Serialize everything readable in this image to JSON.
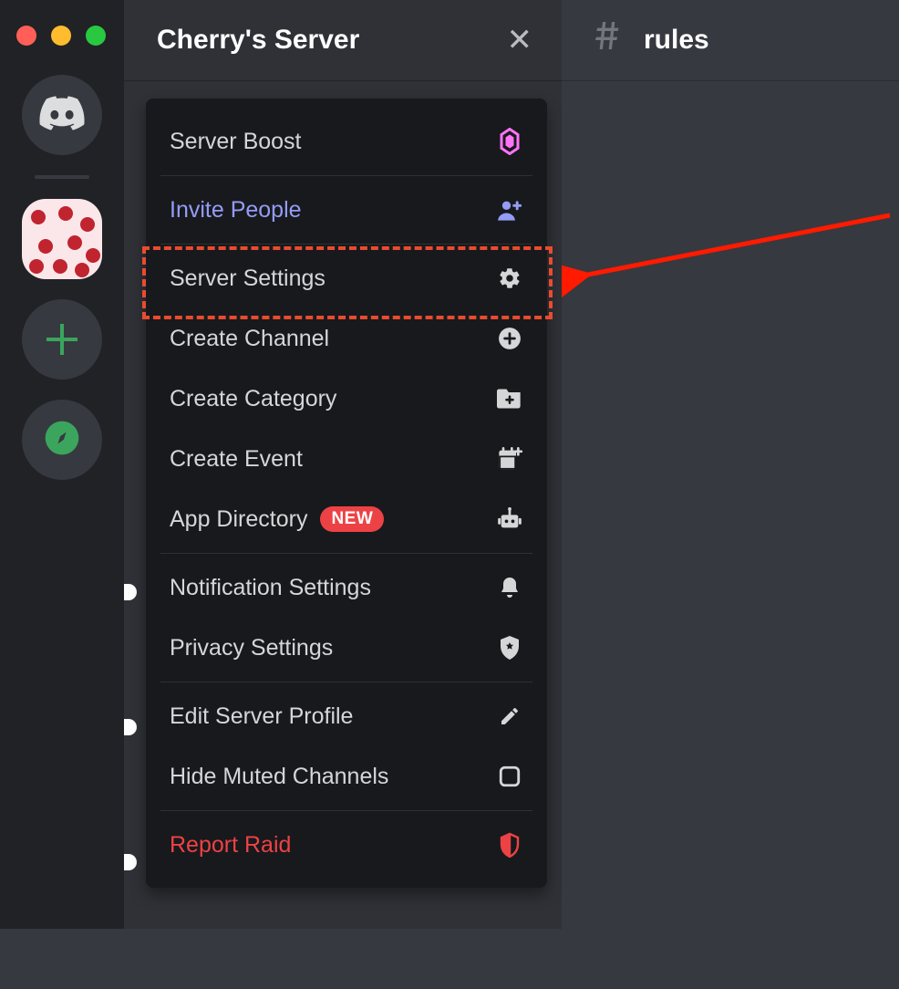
{
  "colors": {
    "traffic_red": "#ff5f57",
    "traffic_yellow": "#febc2e",
    "traffic_green": "#28c840",
    "invite": "#949cf7",
    "danger": "#ed4245",
    "boost": "#ff73fa"
  },
  "header": {
    "server_name": "Cherry's Server",
    "close_glyph": "✕"
  },
  "channel_header": {
    "name": "rules"
  },
  "menu": {
    "server_boost": "Server Boost",
    "invite_people": "Invite People",
    "server_settings": "Server Settings",
    "create_channel": "Create Channel",
    "create_category": "Create Category",
    "create_event": "Create Event",
    "app_directory": "App Directory",
    "app_directory_badge": "NEW",
    "notification_settings": "Notification Settings",
    "privacy_settings": "Privacy Settings",
    "edit_server_profile": "Edit Server Profile",
    "hide_muted_channels": "Hide Muted Channels",
    "report_raid": "Report Raid"
  },
  "annotation": {
    "highlighted_item": "Server Settings"
  }
}
